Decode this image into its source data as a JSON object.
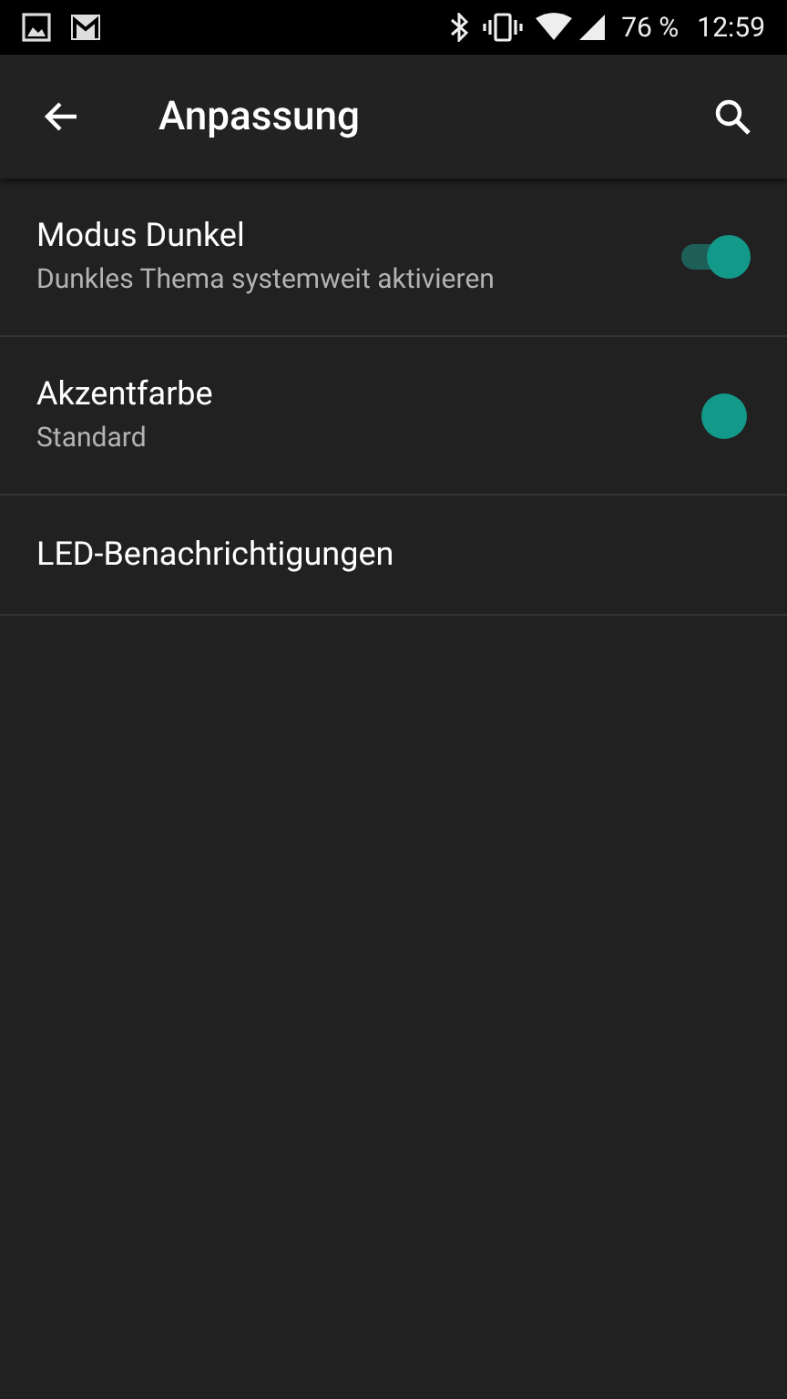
{
  "status_bar": {
    "battery": "76 %",
    "time": "12:59"
  },
  "app_bar": {
    "title": "Anpassung"
  },
  "settings": [
    {
      "kind": "toggle",
      "title": "Modus Dunkel",
      "summary": "Dunkles Thema systemweit aktivieren",
      "on": true
    },
    {
      "kind": "color",
      "title": "Akzentfarbe",
      "summary": "Standard",
      "color": "#13998a"
    },
    {
      "kind": "plain",
      "title": "LED-Benachrichtigungen"
    }
  ]
}
